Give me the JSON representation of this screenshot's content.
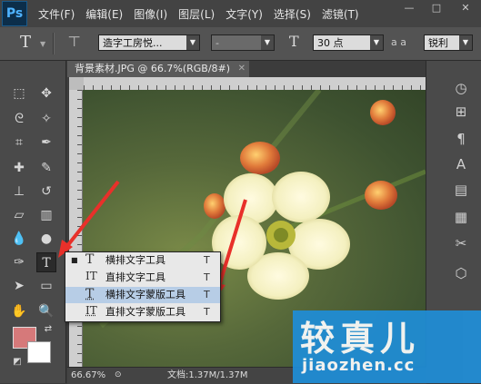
{
  "app": {
    "logo_text": "Ps"
  },
  "menubar": {
    "items": [
      "文件(F)",
      "编辑(E)",
      "图像(I)",
      "图层(L)",
      "文字(Y)",
      "选择(S)",
      "滤镜(T)"
    ],
    "window_controls": [
      "—",
      "□",
      "✕"
    ]
  },
  "options_bar": {
    "font_family": "造字工房悦...",
    "font_style": "-",
    "font_size": "30 点",
    "aa_label": "a a",
    "antialias": "锐利"
  },
  "document": {
    "tab_title": "背景素材.JPG @ 66.7%(RGB/8#)",
    "close_glyph": "✕"
  },
  "status": {
    "zoom": "66.67%",
    "doc_size": "文档:1.37M/1.37M"
  },
  "colors": {
    "foreground": "#d6797a",
    "background": "#ffffff",
    "accent_arrow": "#e8302a"
  },
  "flyout": {
    "items": [
      {
        "icon": "T",
        "label": "横排文字工具",
        "key": "T",
        "selected": true
      },
      {
        "icon": "IT",
        "label": "直排文字工具",
        "key": "T",
        "selected": false
      },
      {
        "icon": "T",
        "label": "横排文字蒙版工具",
        "key": "T",
        "selected": false
      },
      {
        "icon": "IT",
        "label": "直排文字蒙版工具",
        "key": "T",
        "selected": false
      }
    ],
    "selected_bullet": "■"
  },
  "watermark": {
    "title": "较真儿",
    "url": "jiaozhen.cc"
  }
}
